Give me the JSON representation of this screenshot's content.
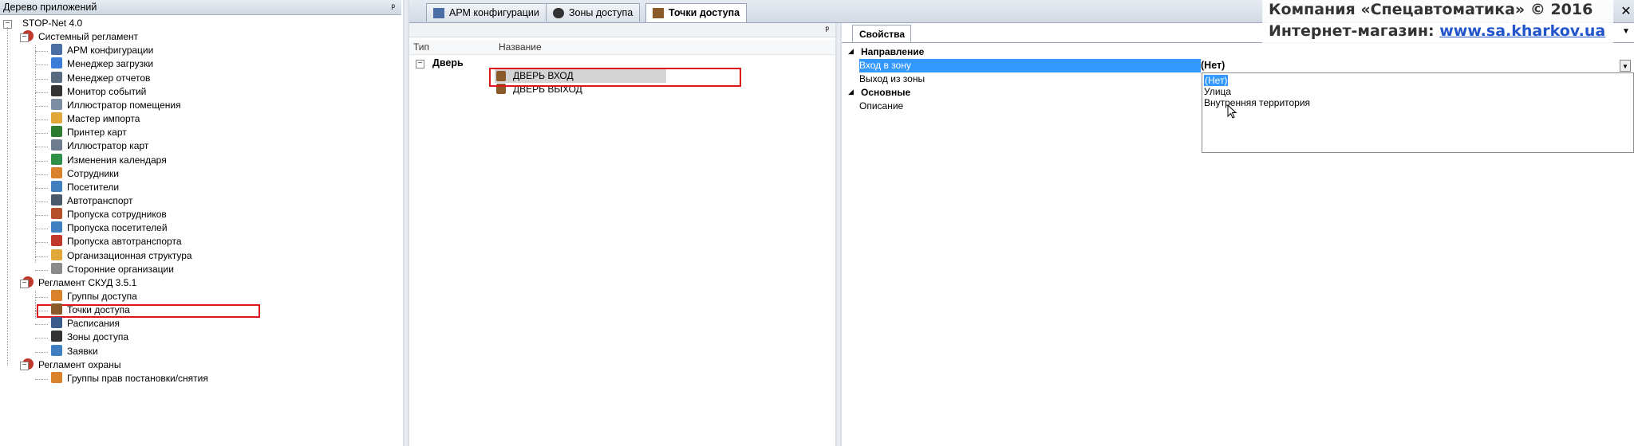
{
  "left_panel": {
    "title": "Дерево приложений",
    "pin": "ᵖ",
    "tree": [
      {
        "label": "STOP-Net 4.0",
        "level": 0,
        "icon": "none",
        "color": ""
      },
      {
        "label": "Системный регламент",
        "level": 1,
        "icon": "regulation-icon",
        "color": "#c0392b"
      },
      {
        "label": "АРМ конфигурации",
        "level": 2,
        "icon": "workstation-icon",
        "color": "#4a6fa5"
      },
      {
        "label": "Менеджер загрузки",
        "level": 2,
        "icon": "loader-icon",
        "color": "#3b7dd8"
      },
      {
        "label": "Менеджер отчетов",
        "level": 2,
        "icon": "report-icon",
        "color": "#5b6b7f"
      },
      {
        "label": "Монитор событий",
        "level": 2,
        "icon": "event-monitor-icon",
        "color": "#333333"
      },
      {
        "label": "Иллюстратор помещения",
        "level": 2,
        "icon": "room-illustrator-icon",
        "color": "#7d8ea3"
      },
      {
        "label": "Мастер импорта",
        "level": 2,
        "icon": "import-wizard-icon",
        "color": "#e0a83a"
      },
      {
        "label": "Принтер карт",
        "level": 2,
        "icon": "card-printer-icon",
        "color": "#2e7d32"
      },
      {
        "label": "Иллюстратор карт",
        "level": 2,
        "icon": "card-illustrator-icon",
        "color": "#6d7c8f"
      },
      {
        "label": "Изменения календаря",
        "level": 2,
        "icon": "calendar-icon",
        "color": "#2f8f46"
      },
      {
        "label": "Сотрудники",
        "level": 2,
        "icon": "employees-icon",
        "color": "#d9822b"
      },
      {
        "label": "Посетители",
        "level": 2,
        "icon": "visitors-icon",
        "color": "#3f7fbf"
      },
      {
        "label": "Автотранспорт",
        "level": 2,
        "icon": "car-icon",
        "color": "#4a5a6a"
      },
      {
        "label": "Пропуска сотрудников",
        "level": 2,
        "icon": "employee-pass-icon",
        "color": "#b5502b"
      },
      {
        "label": "Пропуска посетителей",
        "level": 2,
        "icon": "visitor-pass-icon",
        "color": "#3f7fbf"
      },
      {
        "label": "Пропуска автотранспорта",
        "level": 2,
        "icon": "vehicle-pass-icon",
        "color": "#c0392b"
      },
      {
        "label": "Организационная структура",
        "level": 2,
        "icon": "org-structure-icon",
        "color": "#e0a83a"
      },
      {
        "label": "Сторонние организации",
        "level": 2,
        "icon": "third-party-icon",
        "color": "#8a8a8a"
      },
      {
        "label": "Регламент СКУД 3.5.1",
        "level": 1,
        "icon": "regulation-icon",
        "color": "#c0392b"
      },
      {
        "label": "Группы доступа",
        "level": 2,
        "icon": "access-groups-icon",
        "color": "#d9822b"
      },
      {
        "label": "Точки доступа",
        "level": 2,
        "icon": "access-point-icon",
        "color": "#8a5a2b"
      },
      {
        "label": "Расписания",
        "level": 2,
        "icon": "schedule-icon",
        "color": "#3b5b8a"
      },
      {
        "label": "Зоны доступа",
        "level": 2,
        "icon": "access-zones-icon",
        "color": "#333333"
      },
      {
        "label": "Заявки",
        "level": 2,
        "icon": "requests-icon",
        "color": "#3f7fbf"
      },
      {
        "label": "Регламент охраны",
        "level": 1,
        "icon": "regulation-icon",
        "color": "#c0392b"
      },
      {
        "label": "Группы прав постановки/снятия",
        "level": 2,
        "icon": "arming-rights-icon",
        "color": "#d9822b"
      }
    ]
  },
  "tabs": [
    {
      "label": "АРМ конфигурации",
      "icon": "workstation-icon",
      "active": false
    },
    {
      "label": "Зоны доступа",
      "icon": "access-zones-icon",
      "active": false
    },
    {
      "label": "Точки доступа",
      "icon": "access-point-icon",
      "active": true
    }
  ],
  "middle": {
    "pin": "ᵖ",
    "columns": [
      "Тип",
      "Название"
    ],
    "group_label": "Дверь",
    "rows": [
      {
        "name": "ДВЕРЬ ВХОД",
        "selected": true
      },
      {
        "name": "ДВЕРЬ ВЫХОД",
        "selected": false
      }
    ]
  },
  "properties": {
    "tab_label": "Свойства",
    "sections": [
      {
        "title": "Направление",
        "items": [
          {
            "label": "Вход в зону",
            "value": "(Нет)",
            "selected": true
          },
          {
            "label": "Выход из зоны",
            "value": "",
            "selected": false
          }
        ]
      },
      {
        "title": "Основные",
        "items": [
          {
            "label": "Описание",
            "value": "",
            "selected": false
          }
        ]
      }
    ],
    "dropdown_options": [
      "(Нет)",
      "Улица",
      "Внутренняя территория"
    ],
    "dropdown_selected_index": 0
  },
  "watermark": {
    "line1": "Компания «Спецавтоматика» © 2016",
    "line2_prefix": "Интернет-магазин: ",
    "line2_link": "www.sa.kharkov.ua"
  },
  "colors": {
    "selection": "#3399ff",
    "highlight_box": "#e0141b",
    "row_selected": "#d4d4d4"
  }
}
